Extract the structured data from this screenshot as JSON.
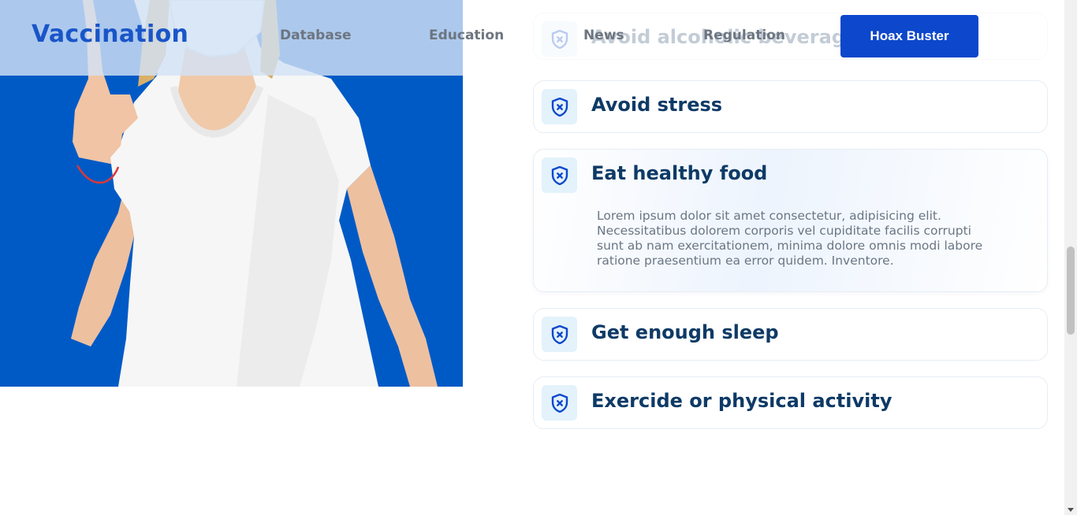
{
  "brand": "Vaccination",
  "nav": {
    "database": "Database",
    "education": "Education",
    "news": "News",
    "regulation": "Regulation",
    "cta": "Hoax Buster"
  },
  "hero": {
    "image": "woman-in-white-tshirt-with-face-mask-raising-finger",
    "background_color": "#005ac6"
  },
  "tips": [
    {
      "title": "Avoid alcoholic beverages",
      "icon": "shield-icon",
      "expanded": false
    },
    {
      "title": "Avoid stress",
      "icon": "shield-icon",
      "expanded": false
    },
    {
      "title": "Eat healthy food",
      "icon": "shield-icon",
      "expanded": true,
      "body": "Lorem ipsum dolor sit amet consectetur, adipisicing elit. Necessitatibus dolorem corporis vel cupiditate facilis corrupti sunt ab nam exercitationem, minima dolore omnis modi labore ratione praesentium ea error quidem. Inventore."
    },
    {
      "title": "Get enough sleep",
      "icon": "shield-icon",
      "expanded": false
    },
    {
      "title": "Exercide or physical activity",
      "icon": "shield-icon",
      "expanded": false
    }
  ],
  "colors": {
    "accent": "#0d47cc",
    "title": "#0e3a66",
    "icon_bg": "#e3f2fb"
  }
}
